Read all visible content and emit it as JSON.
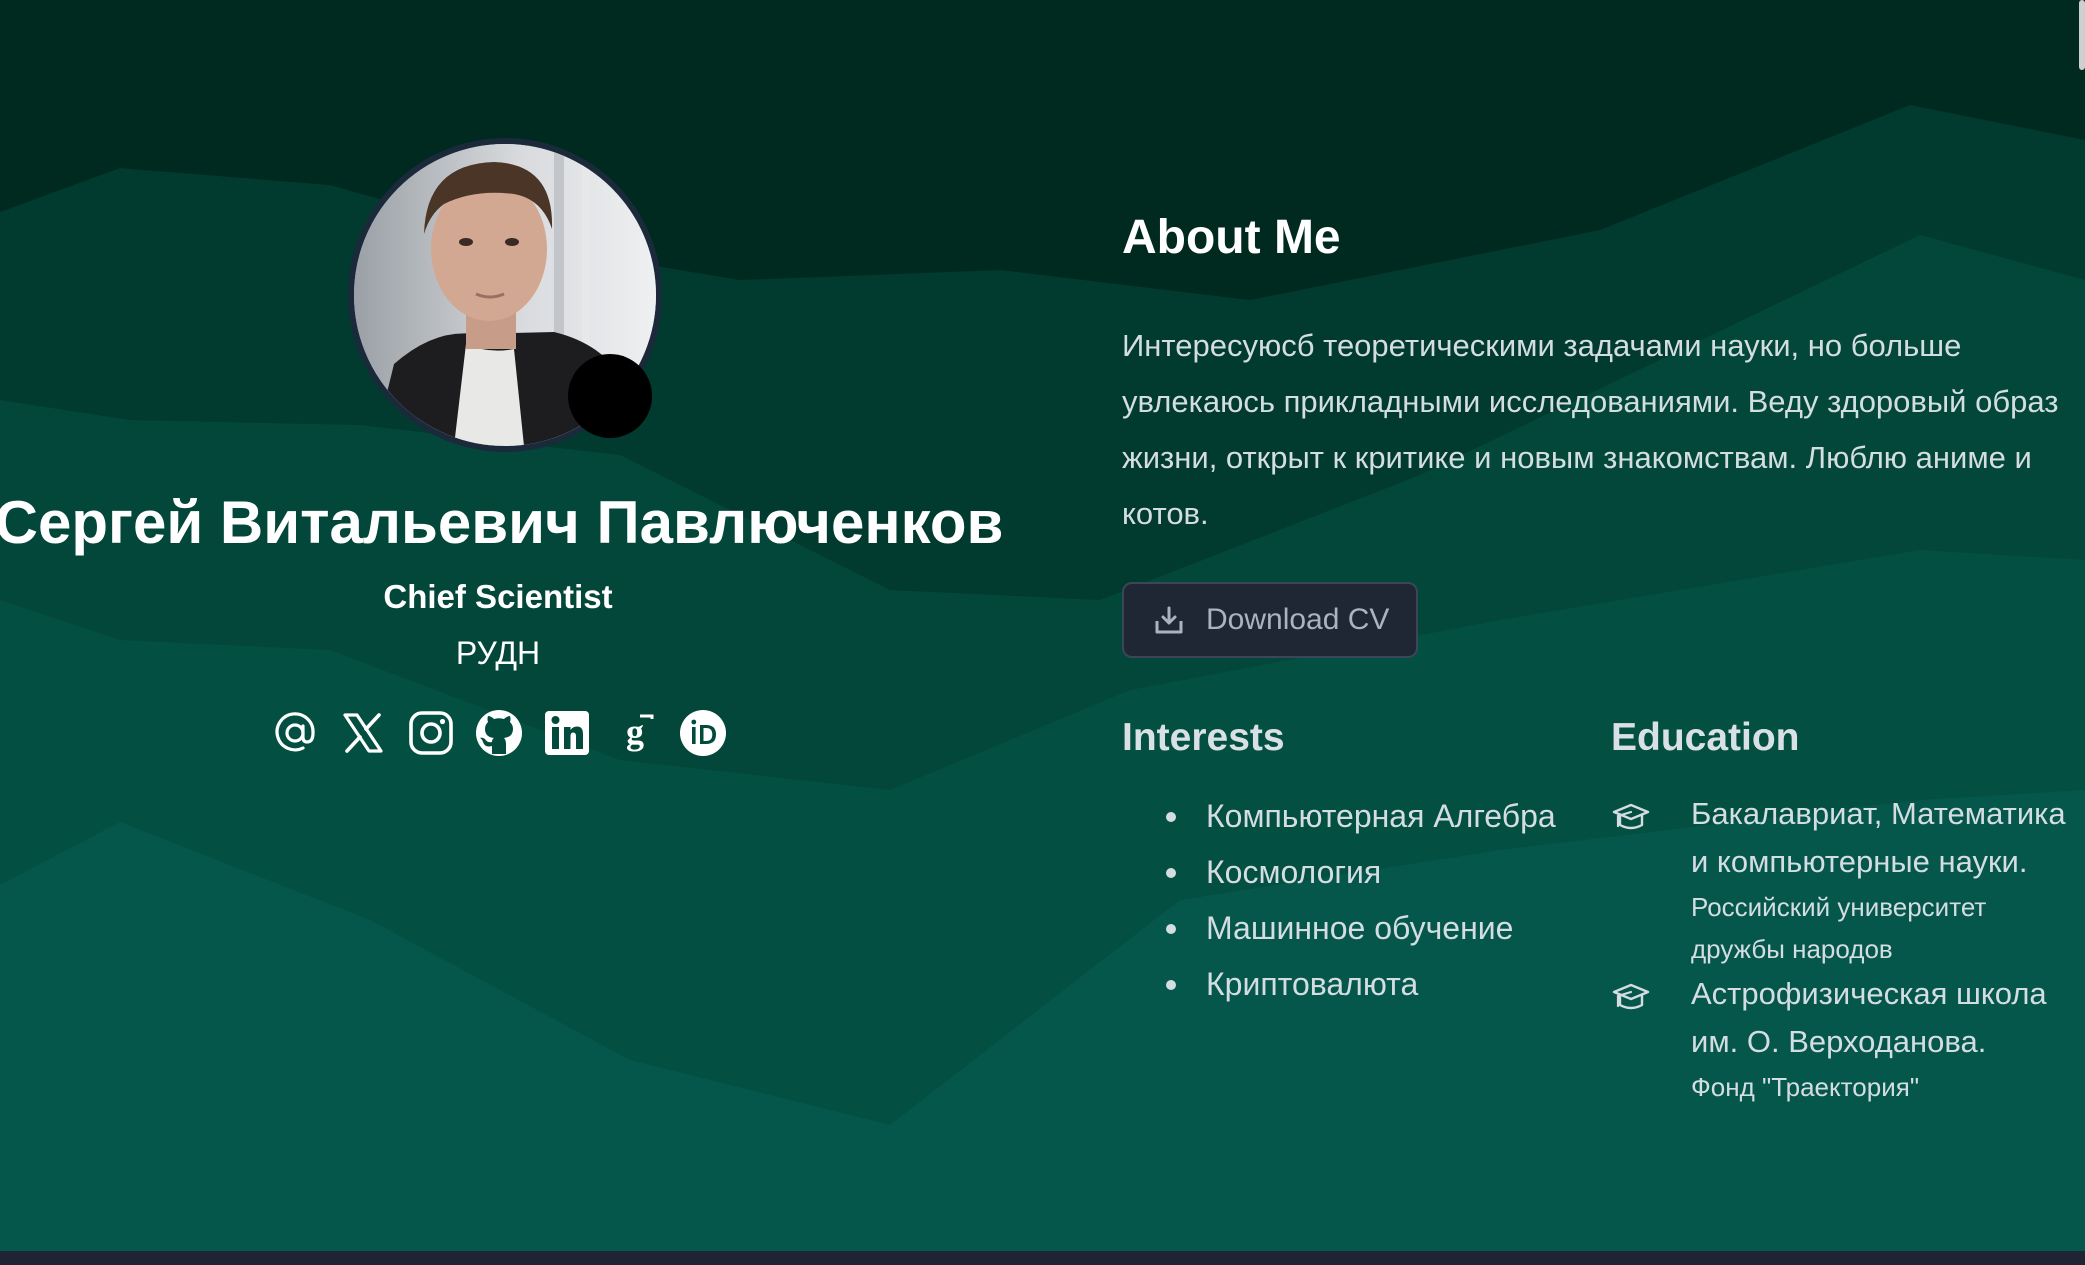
{
  "colors": {
    "bg_top": "#00291f",
    "bg_band_2": "#013a2e",
    "bg_band_3": "#02473a",
    "bg_band_4": "#03594a",
    "bg_bottom": "#05574c",
    "button_bg": "#1f2735",
    "text_main": "#ffffff",
    "text_muted": "#d4dde2"
  },
  "profile": {
    "name": "Сергей Витальевич Павлюченков",
    "role": "Chief Scientist",
    "organization": "РУДН",
    "status_emoji": "☕",
    "avatar_icon": "person-photo",
    "socials": [
      {
        "name": "email",
        "icon": "at-sign-icon"
      },
      {
        "name": "x",
        "icon": "x-logo-icon"
      },
      {
        "name": "instagram",
        "icon": "instagram-icon"
      },
      {
        "name": "github",
        "icon": "github-icon"
      },
      {
        "name": "linkedin",
        "icon": "linkedin-icon"
      },
      {
        "name": "google-scholar",
        "icon": "google-scholar-icon"
      },
      {
        "name": "orcid",
        "icon": "orcid-icon"
      }
    ]
  },
  "about": {
    "title": "About Me",
    "text": "Интересуюсб теоретическими задачами науки, но больше увлекаюсь прикладными исследованиями. Веду здоровый образ жизни, открыт к критике и новым знакомствам. Люблю аниме и котов.",
    "cv_button": "Download CV"
  },
  "interests": {
    "title": "Interests",
    "items": [
      "Компьютерная Алгебра",
      "Космология",
      "Машинное обучение",
      "Криптовалюта"
    ]
  },
  "education": {
    "title": "Education",
    "items": [
      {
        "degree": "Бакалавриат, Математика и компьютерные науки.",
        "institution": "Российский университет дружбы народов"
      },
      {
        "degree": "Астрофизическая школа им. О. Верходанова.",
        "institution": "Фонд \"Траектория\""
      }
    ]
  }
}
